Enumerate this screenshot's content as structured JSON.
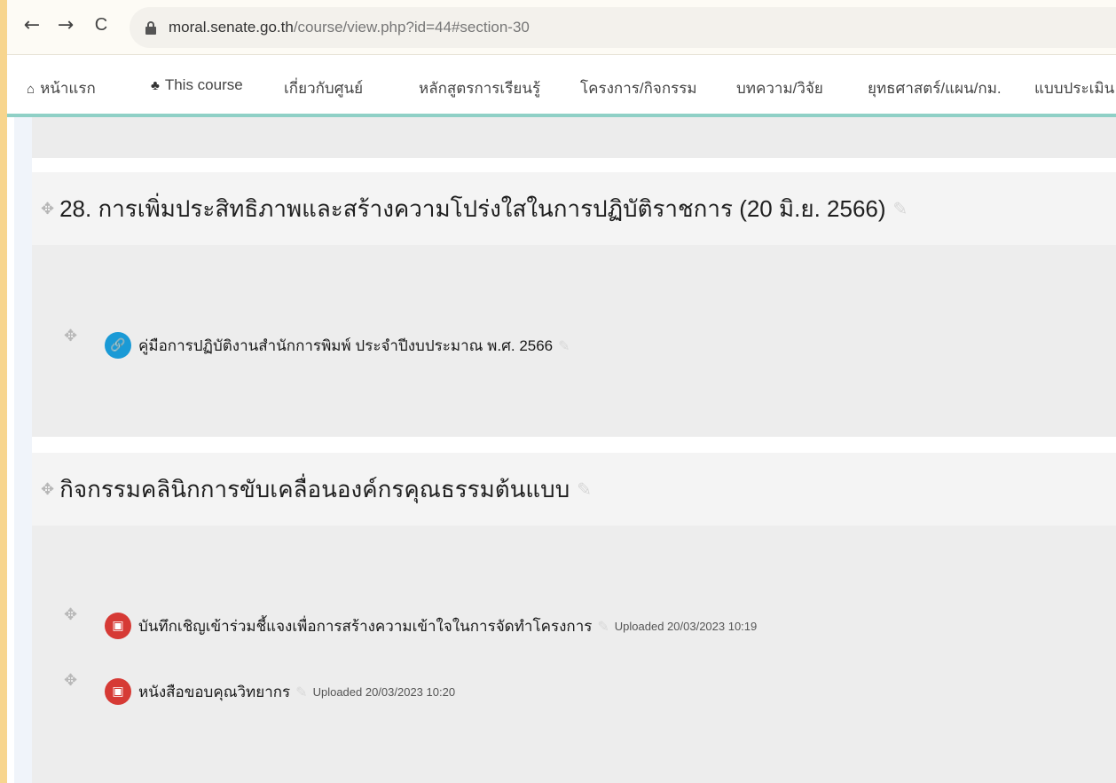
{
  "browser": {
    "back_icon": "←",
    "forward_icon": "→",
    "reload_icon": "C",
    "url_host": "moral.senate.go.th",
    "url_path": "/course/view.php?id=44#section-30"
  },
  "nav": {
    "items": [
      {
        "icon": "home-icon",
        "glyph": "⌂",
        "label": "หน้าแรก"
      },
      {
        "icon": "sitemap-icon",
        "glyph": "♣",
        "label": "This course"
      },
      {
        "label": "เกี่ยวกับศูนย์"
      },
      {
        "label": "หลักสูตรการเรียนรู้"
      },
      {
        "label": "โครงการ/กิจกรรม"
      },
      {
        "label": "บทความ/วิจัย"
      },
      {
        "label": "ยุทธศาสตร์/แผน/กม."
      },
      {
        "label": "แบบประเมิน"
      }
    ]
  },
  "sections": [
    {
      "title": "28. การเพิ่มประสิทธิภาพและสร้างความโปร่งใสในการปฏิบัติราชการ (20 มิ.ย. 2566)",
      "activities": [
        {
          "type": "url",
          "label": "คู่มือการปฏิบัติงานสำนักการพิมพ์ ประจำปีงบประมาณ พ.ศ. 2566",
          "meta": ""
        }
      ]
    },
    {
      "title": "กิจกรรมคลินิกการขับเคลื่อนองค์กรคุณธรรมต้นแบบ",
      "activities": [
        {
          "type": "pdf",
          "label": "บันทึกเชิญเข้าร่วมชี้แจงเพื่อการสร้างความเข้าใจในการจัดทำโครงการ",
          "meta": "Uploaded 20/03/2023 10:19"
        },
        {
          "type": "pdf",
          "label": "หนังสือขอบคุณวิทยากร",
          "meta": "Uploaded 20/03/2023 10:20"
        }
      ]
    }
  ],
  "icons": {
    "move": "✥",
    "edit": "✎",
    "url": "🔗",
    "pdf": "▣"
  }
}
